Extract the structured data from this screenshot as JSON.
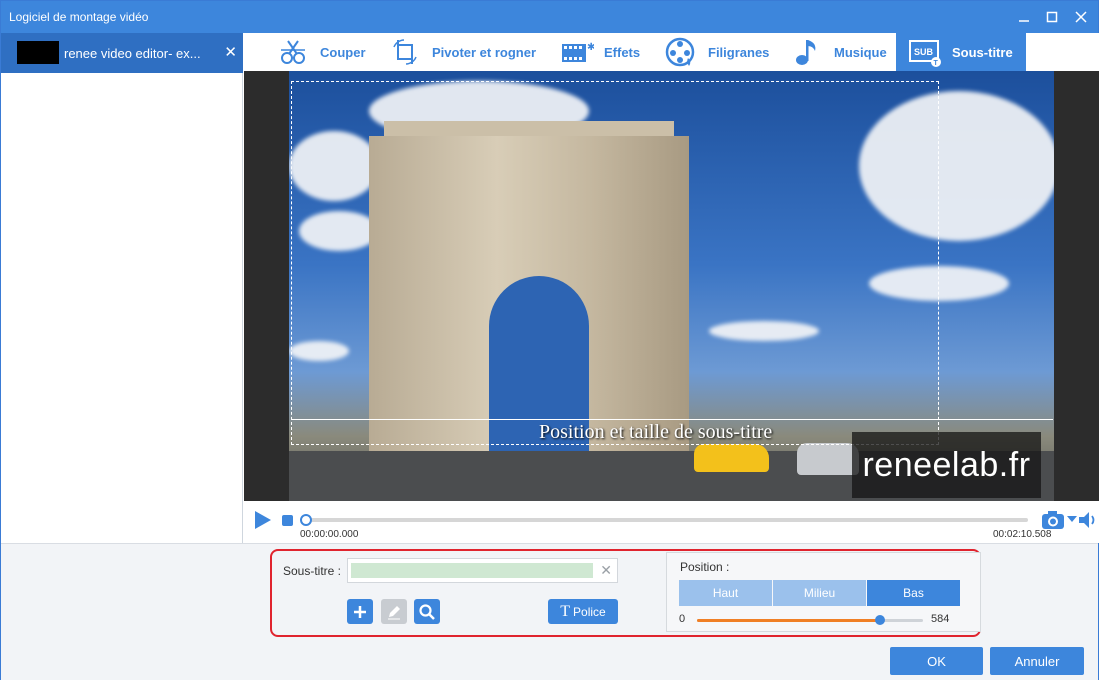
{
  "window": {
    "title": "Logiciel de montage vidéo"
  },
  "file": {
    "name": "renee video editor- ex..."
  },
  "tabs": [
    {
      "label": "Couper",
      "icon": "scissors-icon"
    },
    {
      "label": "Pivoter et rogner",
      "icon": "crop-rotate-icon"
    },
    {
      "label": "Effets",
      "icon": "effects-film-icon"
    },
    {
      "label": "Filigranes",
      "icon": "watermark-reel-icon"
    },
    {
      "label": "Musique",
      "icon": "music-note-icon"
    },
    {
      "label": "Sous-titre",
      "icon": "subtitle-icon",
      "active": true
    }
  ],
  "video": {
    "subtitle_preview": "Position et taille de sous-titre",
    "watermark": "reneelab.fr"
  },
  "player": {
    "current_time": "00:00:00.000",
    "total_time": "00:02:10.508",
    "progress": 0
  },
  "subtitle_panel": {
    "label": "Sous-titre :",
    "input_value": "",
    "font_button": "Police"
  },
  "position_panel": {
    "label": "Position :",
    "options": [
      "Haut",
      "Milieu",
      "Bas"
    ],
    "selected": "Bas",
    "slider_min": "0",
    "slider_max": "584",
    "slider_fraction": 0.81
  },
  "footer": {
    "ok": "OK",
    "cancel": "Annuler"
  },
  "colors": {
    "accent": "#3d86dc",
    "highlight": "#e0242e",
    "slider_fill": "#f07f25"
  }
}
